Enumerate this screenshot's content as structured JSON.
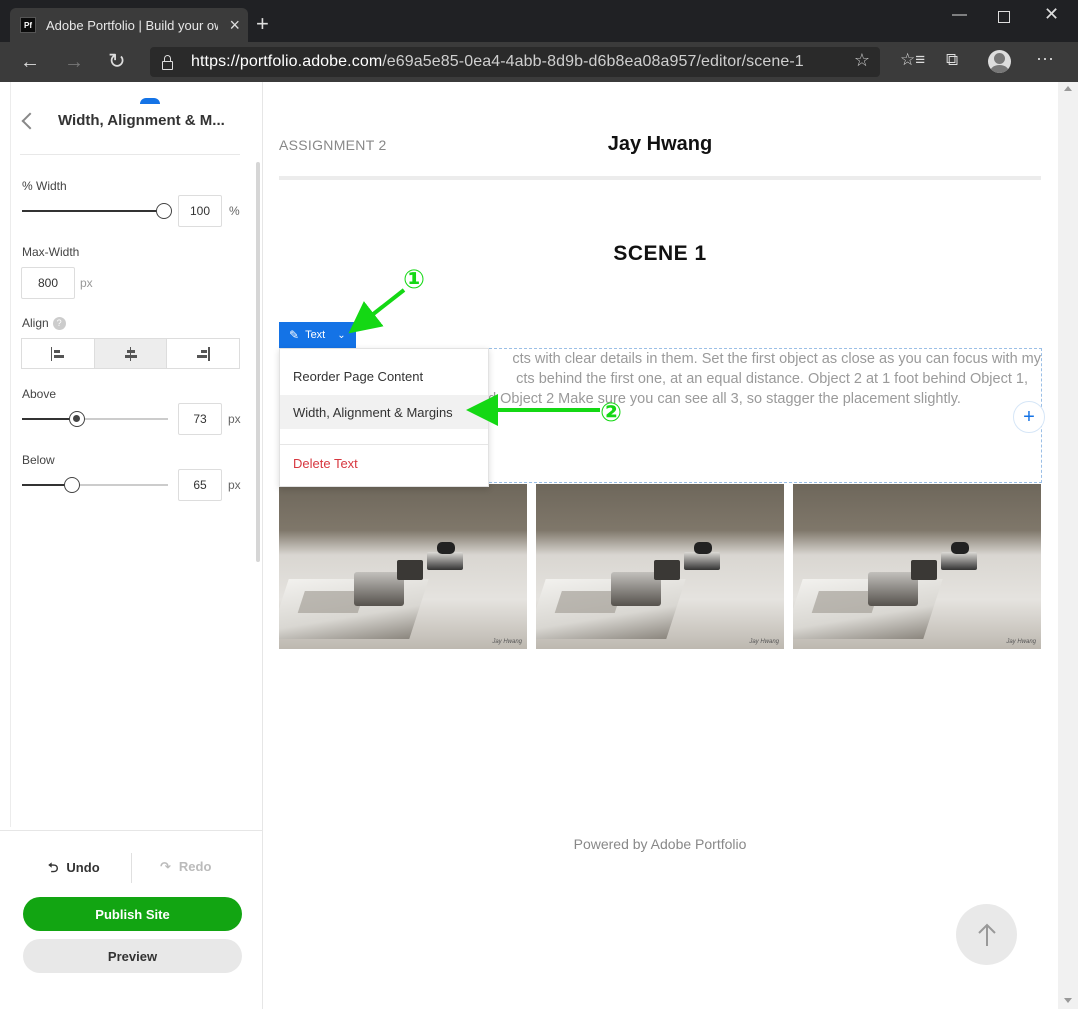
{
  "browser": {
    "tab_title": "Adobe Portfolio | Build your own",
    "favicon_text": "Pf",
    "url_host": "https://portfolio.adobe.com",
    "url_path": "/e69a5e85-0ea4-4abb-8d9b-d6b8ea08a957/editor/scene-1"
  },
  "panel": {
    "title": "Width, Alignment & M...",
    "width_label": "% Width",
    "width_value": "100",
    "width_unit": "%",
    "width_fraction": 1.0,
    "maxwidth_label": "Max-Width",
    "maxwidth_value": "800",
    "maxwidth_unit": "px",
    "align_label": "Align",
    "align_options": [
      "left",
      "center",
      "right"
    ],
    "align_selected": "center",
    "above_label": "Above",
    "above_value": "73",
    "above_unit": "px",
    "above_fraction": 0.37,
    "below_label": "Below",
    "below_value": "65",
    "below_unit": "px",
    "below_fraction": 0.33,
    "undo_label": "Undo",
    "redo_label": "Redo",
    "publish_label": "Publish Site",
    "preview_label": "Preview"
  },
  "page": {
    "assignment": "ASSIGNMENT 2",
    "site_title": "Jay Hwang",
    "scene_title": "SCENE 1",
    "body_lines": [
      "cts with clear details in them. Set the first object as close as you can focus with my",
      "cts behind the first one, at an equal distance. Object 2 at 1 foot behind Object 1,",
      "nd Object 2 Make sure you can see all 3, so stagger the placement slightly."
    ],
    "footer": "Powered by Adobe Portfolio",
    "photo_watermark": "Jay Hwang"
  },
  "editor": {
    "chip_label": "Text",
    "menu": {
      "reorder": "Reorder Page Content",
      "width_align": "Width, Alignment & Margins",
      "delete": "Delete Text"
    }
  },
  "annotations": {
    "step1": "①",
    "step2": "②",
    "color": "#14d814"
  },
  "colors": {
    "accent": "#1473e6",
    "publish": "#12a512",
    "danger": "#d7373f"
  }
}
